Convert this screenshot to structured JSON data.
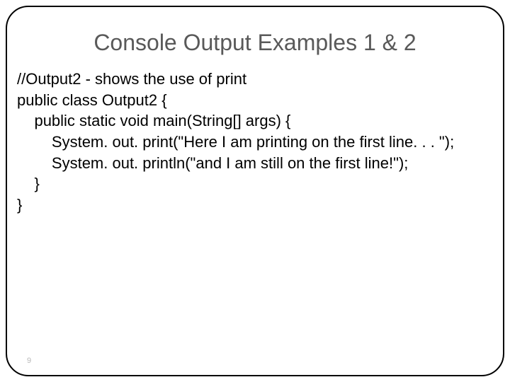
{
  "slide": {
    "title": "Console Output Examples 1 & 2",
    "code_lines": {
      "l0": "//Output2 - shows the use of print",
      "l1": "public class Output2 {",
      "l2": "    public static void main(String[] args) {",
      "l3": "        System. out. print(\"Here I am printing on the first line. . . \");",
      "l4": "        System. out. println(\"and I am still on the first line!\");",
      "l5": "    }",
      "l6": "}"
    },
    "page_number": "9"
  }
}
